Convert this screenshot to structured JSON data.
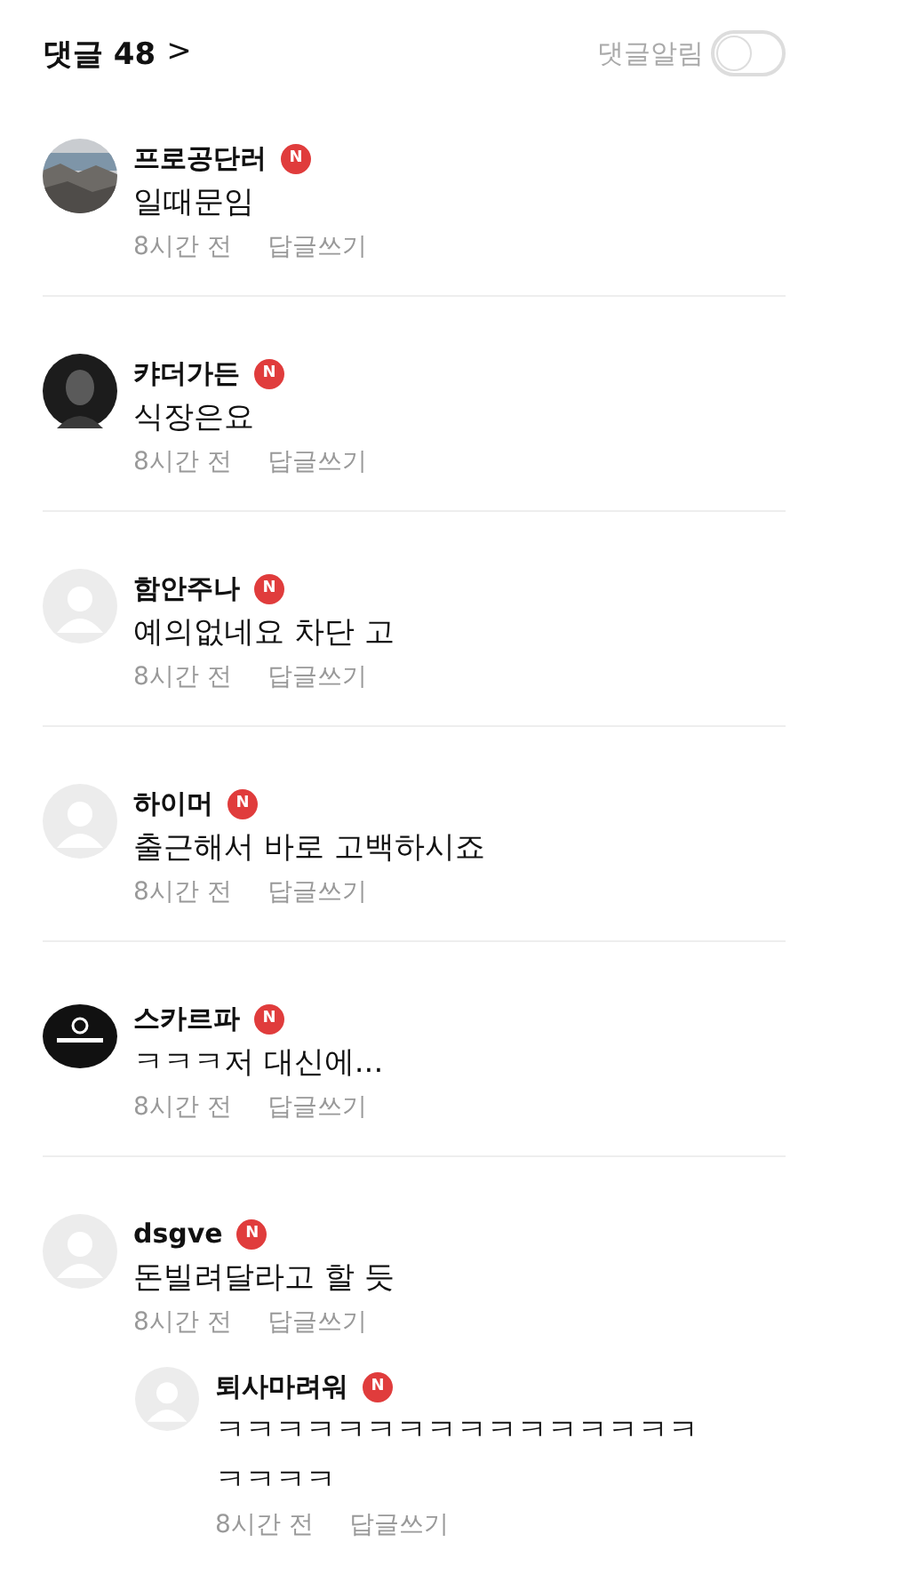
{
  "header": {
    "title": "댓글 48",
    "chevron": ">",
    "alert_label": "댓글알림",
    "alert_on": false
  },
  "comments": [
    {
      "author": "프로공단러",
      "badge": "N",
      "kind": "landscape",
      "text": "일때문임",
      "time": "8시간 전",
      "reply_link": "답글쓰기"
    },
    {
      "author": "캬더가든",
      "badge": "N",
      "kind": "dark",
      "text": "식장은요",
      "time": "8시간 전",
      "reply_link": "답글쓰기"
    },
    {
      "author": "함안주나",
      "badge": "N",
      "kind": "default",
      "text": "예의없네요 차단 고",
      "time": "8시간 전",
      "reply_link": "답글쓰기"
    },
    {
      "author": "하이머",
      "badge": "N",
      "kind": "default",
      "text": "출근해서 바로 고백하시죠",
      "time": "8시간 전",
      "reply_link": "답글쓰기"
    },
    {
      "author": "스카르파",
      "badge": "N",
      "kind": "logo",
      "text": "ㅋㅋㅋ저 대신에...",
      "time": "8시간 전",
      "reply_link": "답글쓰기"
    },
    {
      "author": "dsgve",
      "badge": "N",
      "kind": "default",
      "text": "돈빌려달라고 할 듯",
      "time": "8시간 전",
      "reply_link": "답글쓰기",
      "replies": [
        {
          "author": "퇴사마려워",
          "badge": "N",
          "kind": "default",
          "text": "ㅋㅋㅋㅋㅋㅋㅋㅋㅋㅋㅋㅋㅋㅋㅋㅋㅋㅋㅋㅋ",
          "time": "8시간 전",
          "reply_link": "답글쓰기"
        }
      ]
    }
  ]
}
